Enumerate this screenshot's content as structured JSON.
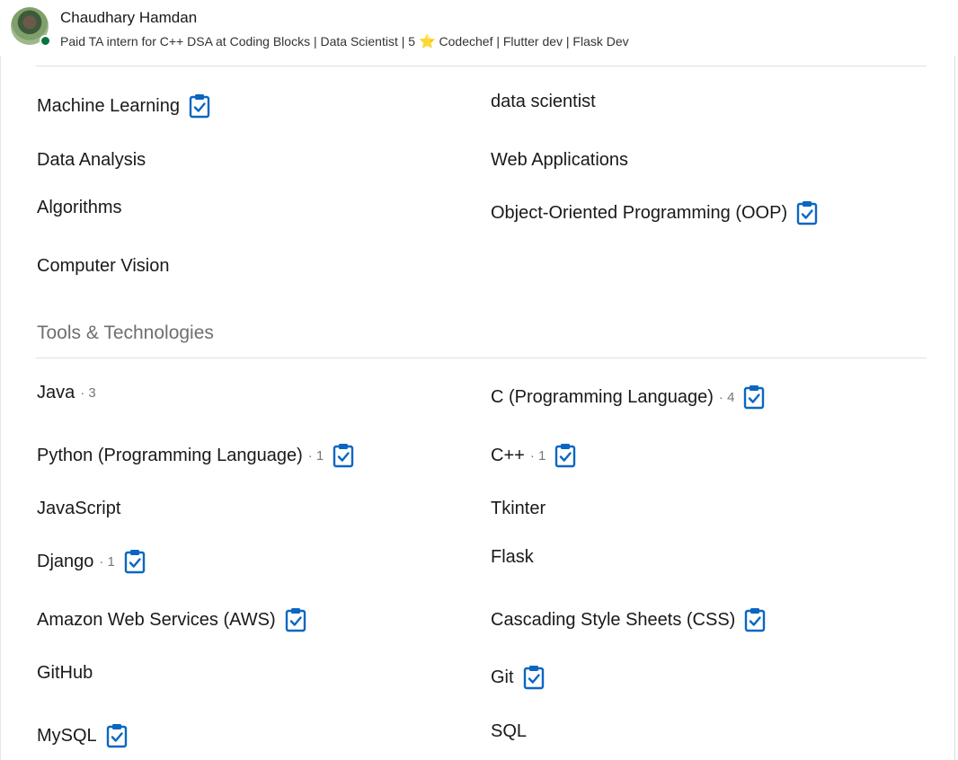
{
  "header": {
    "name": "Chaudhary Hamdan",
    "headline_before": "Paid TA intern for C++ DSA at Coding Blocks | Data Scientist | 5",
    "headline_star": "⭐",
    "headline_after": "Codechef | Flutter dev | Flask Dev"
  },
  "skills": {
    "machine_learning": "Machine Learning",
    "data_scientist": "data scientist",
    "data_analysis": "Data Analysis",
    "web_applications": "Web Applications",
    "algorithms": "Algorithms",
    "oop": "Object-Oriented Programming (OOP)",
    "computer_vision": "Computer Vision"
  },
  "tools": {
    "section_title": "Tools & Technologies",
    "java": "Java",
    "java_count": "· 3",
    "c_lang": "C (Programming Language)",
    "c_count": "· 4",
    "python": "Python (Programming Language)",
    "python_count": "· 1",
    "cpp": "C++",
    "cpp_count": "· 1",
    "javascript": "JavaScript",
    "tkinter": "Tkinter",
    "django": "Django",
    "django_count": "· 1",
    "flask": "Flask",
    "aws": "Amazon Web Services (AWS)",
    "css": "Cascading Style Sheets (CSS)",
    "github": "GitHub",
    "git": "Git",
    "mysql": "MySQL",
    "sql": "SQL"
  },
  "colors": {
    "badge": "#0a66c2",
    "online": "#057642",
    "star": "#f5b400"
  },
  "icons": {
    "assessment_badge": "clipboard-check-icon",
    "online": "online-status-dot"
  }
}
